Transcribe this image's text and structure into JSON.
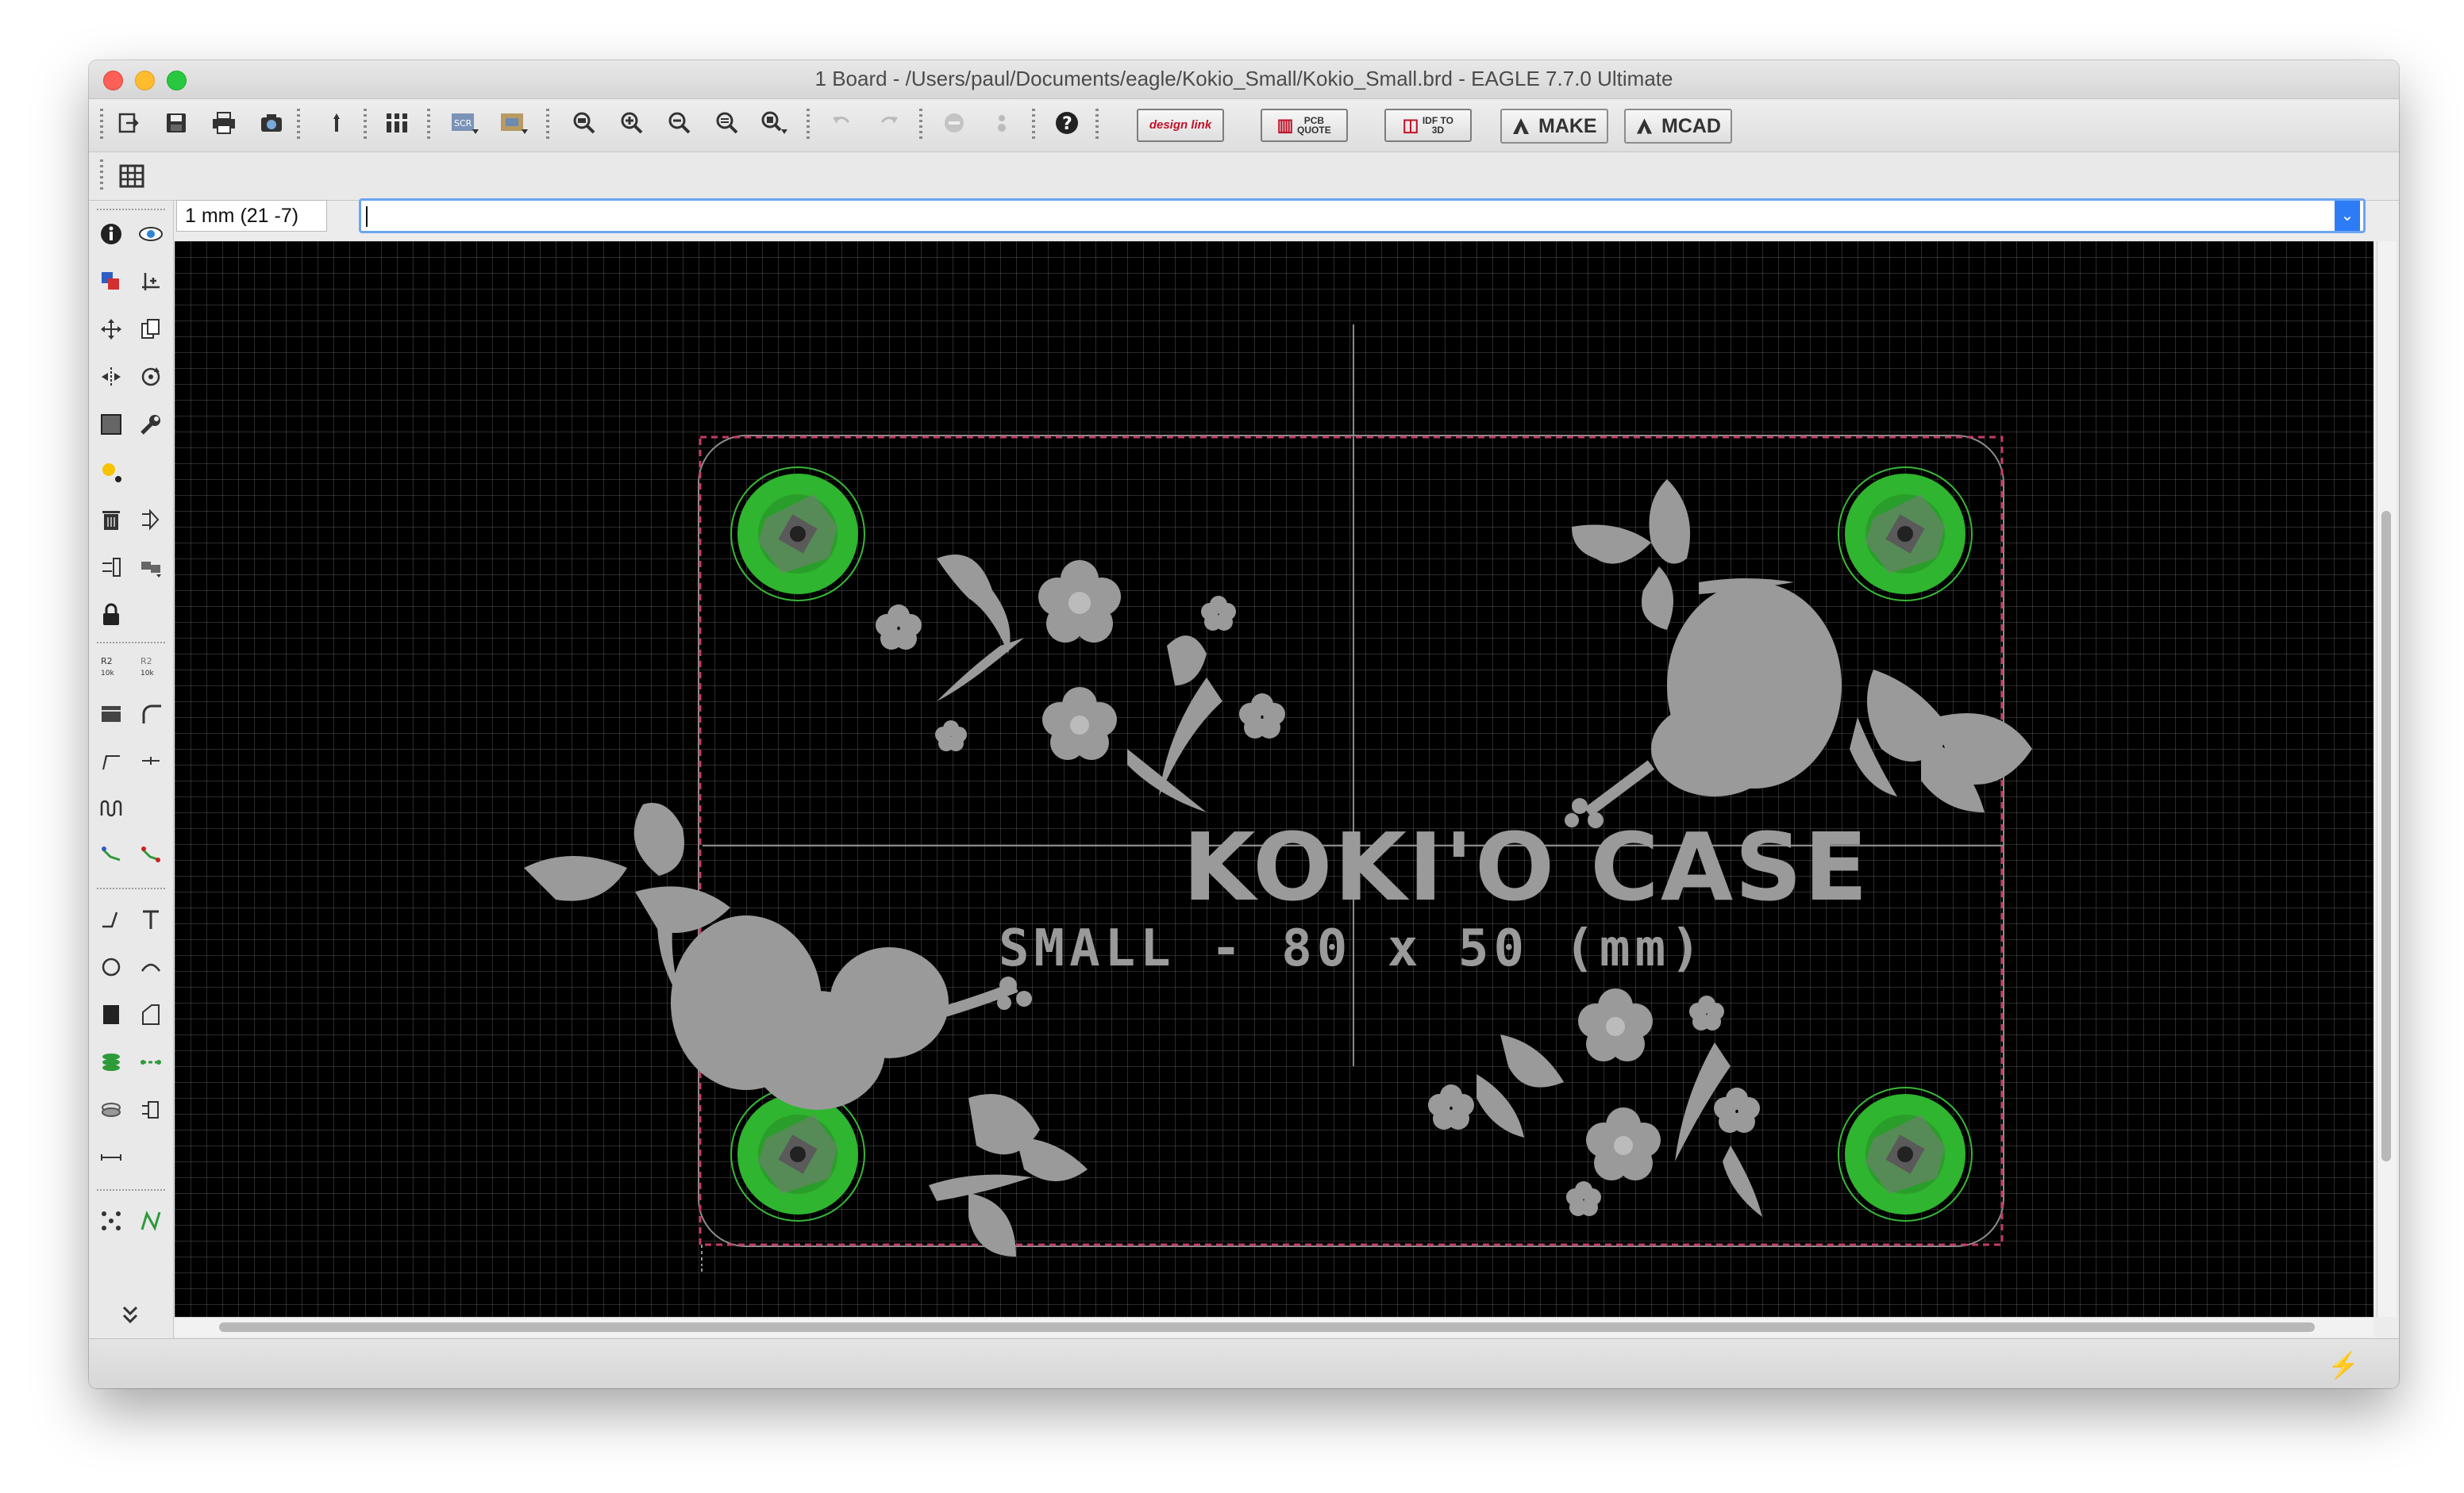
{
  "window": {
    "title": "1 Board - /Users/paul/Documents/eagle/Kokio_Small/Kokio_Small.brd - EAGLE 7.7.0 Ultimate"
  },
  "toolbar": {
    "icons": [
      "open-icon",
      "save-icon",
      "print-icon",
      "cam-icon",
      "script-icon",
      "layers-icon",
      "scr-icon",
      "ulp-icon",
      "zoom-fit-icon",
      "zoom-in-icon",
      "zoom-out-icon",
      "zoom-redraw-icon",
      "zoom-select-icon",
      "undo-icon",
      "redo-icon",
      "stop-icon",
      "go-icon",
      "help-icon"
    ],
    "designlink_label": "design link",
    "pcb_quote_label": "PCB QUOTE",
    "idf_label": "IDF TO 3D",
    "make_label": "MAKE",
    "mcad_label": "MCAD"
  },
  "grid_toolbar": {
    "icon": "grid-icon"
  },
  "command": {
    "coordinate": "1 mm (21 -7)",
    "input_value": ""
  },
  "board": {
    "title": "KOKI'O CASE",
    "subtitle": "SMALL - 80 x 50 (mm)",
    "colors": {
      "background": "#000000",
      "silkscreen": "#9a9a9a",
      "pad": "#2fb52f",
      "outline": "#c23a6a"
    }
  }
}
